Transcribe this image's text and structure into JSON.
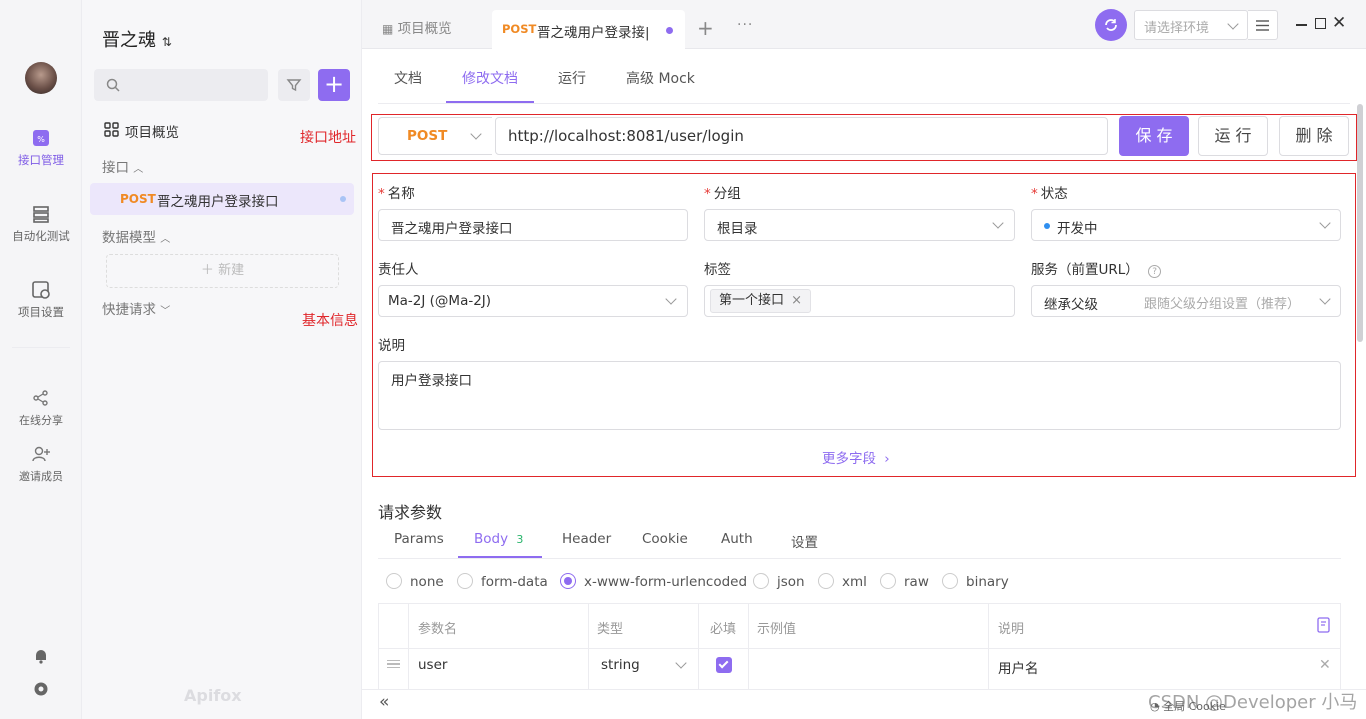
{
  "rail": {
    "items": [
      {
        "label": "接口管理"
      },
      {
        "label": "自动化测试"
      },
      {
        "label": "项目设置"
      },
      {
        "label": "在线分享"
      },
      {
        "label": "邀请成员"
      }
    ]
  },
  "sidebar": {
    "project_name": "晋之魂",
    "overview": "项目概览",
    "section_api": "接口",
    "api_item_method": "POST",
    "api_item_name": "晋之魂用户登录接口",
    "section_model": "数据模型",
    "new_label": "新建",
    "section_quick": "快捷请求",
    "brand": "Apifox"
  },
  "topbar": {
    "tab_overview": "项目概览",
    "tab_method": "POST",
    "tab_name": "晋之魂用户登录接|",
    "env_placeholder": "请选择环境"
  },
  "doc_tabs": [
    "文档",
    "修改文档",
    "运行",
    "高级 Mock"
  ],
  "annotations": {
    "url": "接口地址",
    "basic": "基本信息"
  },
  "request": {
    "method": "POST",
    "url": "http://localhost:8081/user/login",
    "save": "保 存",
    "run": "运 行",
    "delete": "删 除"
  },
  "form": {
    "name_label": "名称",
    "name_value": "晋之魂用户登录接口",
    "group_label": "分组",
    "group_value": "根目录",
    "status_label": "状态",
    "status_value": "开发中",
    "owner_label": "责任人",
    "owner_value": "Ma-2J (@Ma-2J)",
    "tags_label": "标签",
    "tag_value": "第一个接口",
    "service_label": "服务（前置URL）",
    "service_value": "继承父级",
    "service_hint": "跟随父级分组设置（推荐）",
    "desc_label": "说明",
    "desc_value": "用户登录接口",
    "more_fields": "更多字段"
  },
  "params": {
    "title": "请求参数",
    "tabs": [
      "Params",
      "Body",
      "Header",
      "Cookie",
      "Auth",
      "设置"
    ],
    "body_count": "3",
    "body_types": [
      "none",
      "form-data",
      "x-www-form-urlencoded",
      "json",
      "xml",
      "raw",
      "binary"
    ],
    "columns": [
      "参数名",
      "类型",
      "必填",
      "示例值",
      "说明"
    ],
    "row": {
      "name": "user",
      "type": "string",
      "desc": "用户名"
    }
  },
  "footer": {
    "cookie": "全局 Cookie",
    "watermark": "CSDN @Developer 小马"
  },
  "colors": {
    "accent": "#8e6cf0",
    "post": "#f08a24",
    "annot": "#e0262a",
    "status_dot": "#2f8ff0"
  }
}
